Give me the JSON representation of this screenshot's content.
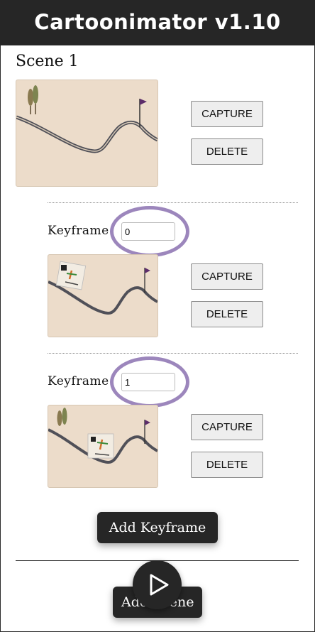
{
  "app": {
    "title": "Cartoonimator v1.10"
  },
  "scene": {
    "title": "Scene 1",
    "capture_label": "CAPTURE",
    "delete_label": "DELETE"
  },
  "keyframes": [
    {
      "label": "Keyframe",
      "value": "0",
      "capture_label": "CAPTURE",
      "delete_label": "DELETE"
    },
    {
      "label": "Keyframe",
      "value": "1",
      "capture_label": "CAPTURE",
      "delete_label": "DELETE"
    }
  ],
  "actions": {
    "add_keyframe_label": "Add Keyframe",
    "add_scene_label": "Add Scene"
  },
  "icons": {
    "play": "play-icon"
  },
  "colors": {
    "header": "#262626",
    "thumbnail_bg": "#ecdcca",
    "highlight_circle": "#9c86bc"
  }
}
